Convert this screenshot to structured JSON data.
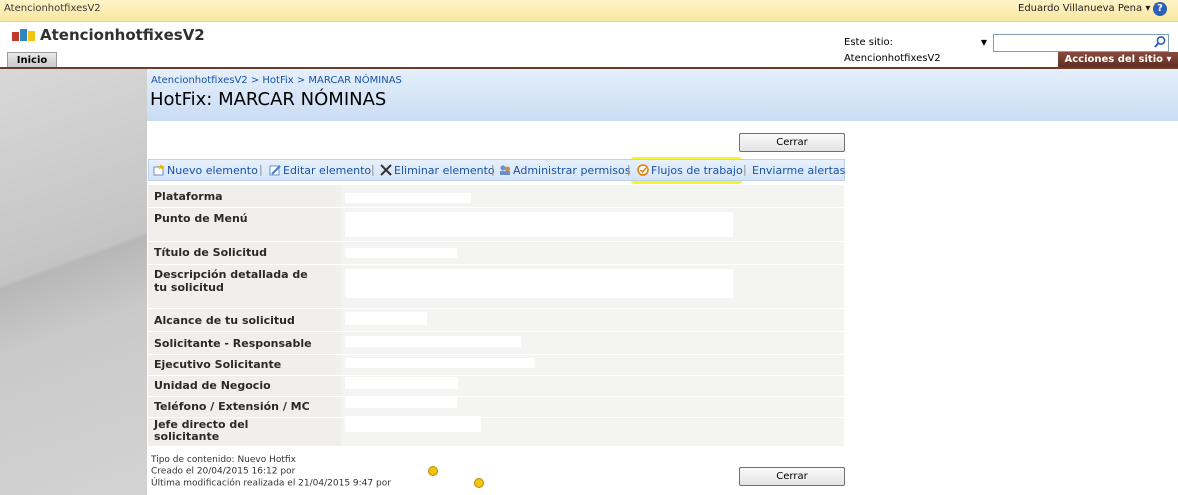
{
  "topbar": {
    "site_name": "AtencionhotfixesV2",
    "user": "Eduardo Villanueva Pena ▾ |",
    "help": "?"
  },
  "header": {
    "site_title": "AtencionhotfixesV2",
    "scope": "Este sitio: AtencionhotfixesV2",
    "search_placeholder": ""
  },
  "nav": {
    "home_tab": "Inicio",
    "site_actions": "Acciones del sitio ▾"
  },
  "page": {
    "breadcrumb": "AtencionhotfixesV2 > HotFix > MARCAR NÓMINAS",
    "title": "HotFix: MARCAR NÓMINAS",
    "close_label": "Cerrar"
  },
  "toolbar": {
    "new_item": "Nuevo elemento",
    "edit_item": "Editar elemento",
    "delete_item": "Eliminar elemento",
    "manage_permissions": "Administrar permisos",
    "workflows": "Flujos de trabajo",
    "alert_me": "Enviarme alertas"
  },
  "fields": [
    {
      "label": "Plataforma"
    },
    {
      "label": "Punto de Menú"
    },
    {
      "label": "Título de Solicitud"
    },
    {
      "label": "Descripción detallada de tu solicitud"
    },
    {
      "label": "Alcance de tu solicitud"
    },
    {
      "label": "Solicitante - Responsable"
    },
    {
      "label": "Ejecutivo Solicitante"
    },
    {
      "label": "Unidad de Negocio"
    },
    {
      "label": "Teléfono / Extensión / MC"
    },
    {
      "label": "Jefe directo del solicitante"
    }
  ],
  "footer": {
    "content_type": "Tipo de contenido: Nuevo Hotfix",
    "created": "Creado el 20/04/2015 16:12  por",
    "modified": "Última modificación realizada el 21/04/2015 9:47  por"
  },
  "colors": {
    "highlight": "#f4f300",
    "link": "#1a52a6",
    "site_actions_bg": "#6f362a"
  }
}
